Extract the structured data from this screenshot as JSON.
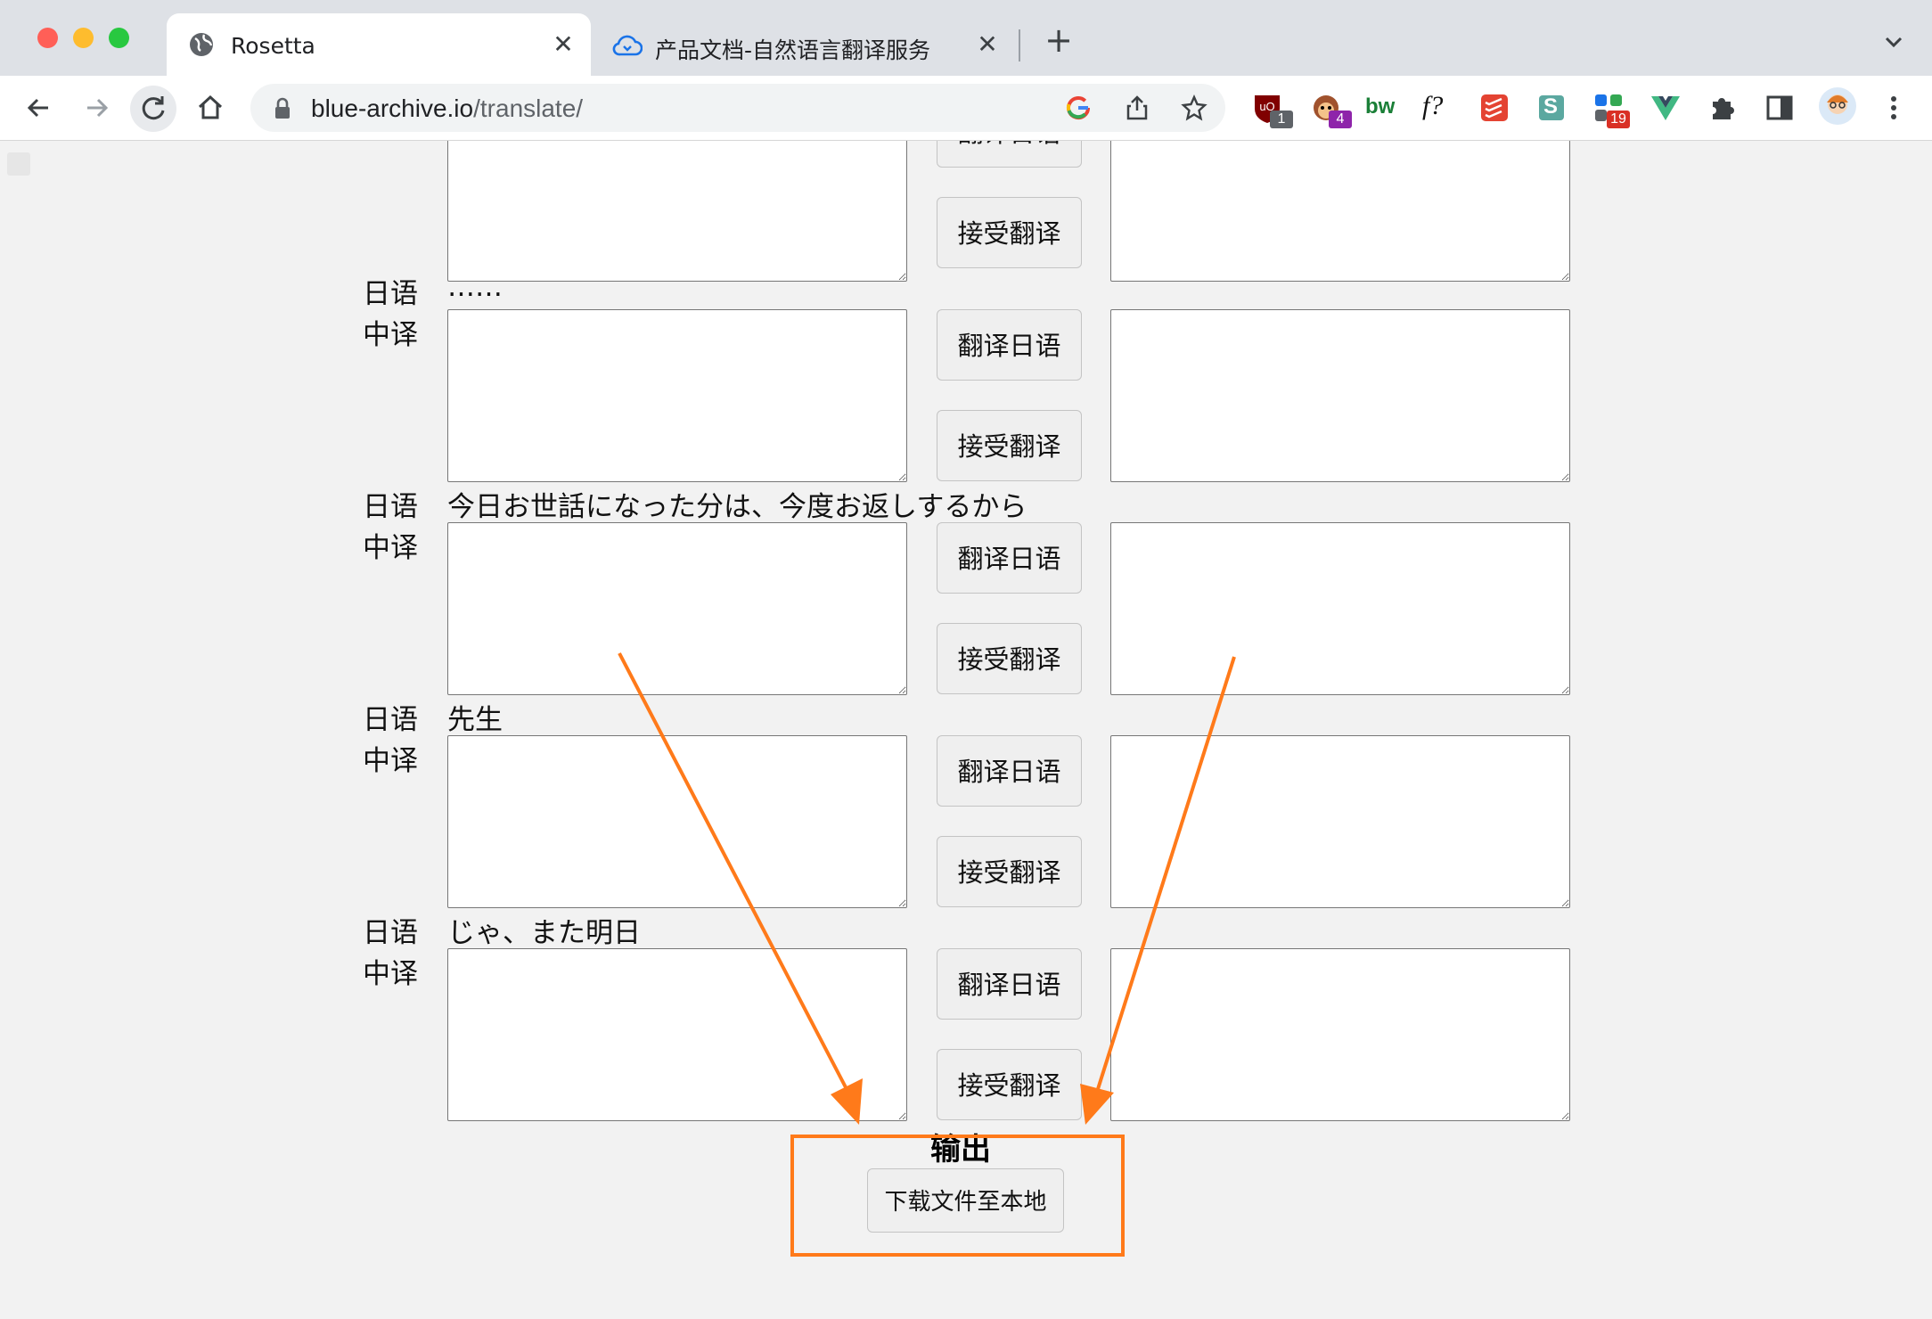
{
  "browser": {
    "tabs": [
      {
        "title": "Rosetta",
        "icon": "globe-icon",
        "active": true
      },
      {
        "title": "产品文档-自然语言翻译服务",
        "icon": "cloud-icon",
        "active": false
      }
    ],
    "url_host": "blue-archive.io",
    "url_path": "/translate/",
    "extensions": [
      {
        "name": "ublock-icon",
        "badge": "1",
        "badge_color": "#5f6368"
      },
      {
        "name": "monkey-icon",
        "badge": "4",
        "badge_color": "#8e24aa"
      },
      {
        "name": "bw-icon",
        "label": "bw"
      },
      {
        "name": "font-icon",
        "label": "f?"
      },
      {
        "name": "todoist-icon"
      },
      {
        "name": "s-icon",
        "label": "S"
      },
      {
        "name": "apps-icon",
        "badge": "19",
        "badge_color": "#d93025"
      },
      {
        "name": "vue-icon"
      },
      {
        "name": "puzzle-icon"
      },
      {
        "name": "sidepanel-icon"
      },
      {
        "name": "avatar-icon"
      },
      {
        "name": "menu-icon"
      }
    ]
  },
  "page": {
    "labels": {
      "ja": "日语",
      "zh": "中译"
    },
    "buttons": {
      "translate": "翻译日语",
      "accept": "接受翻译"
    },
    "rows": [
      {
        "source": ""
      },
      {
        "source": "……"
      },
      {
        "source": "今日お世話になった分は、今度お返しするから"
      },
      {
        "source": "先生"
      },
      {
        "source": "じゃ、また明日"
      }
    ],
    "output_title": "输出",
    "download_label": "下载文件至本地"
  },
  "colors": {
    "annotation": "#ff7a1a",
    "page_bg": "#f2f2f2"
  }
}
